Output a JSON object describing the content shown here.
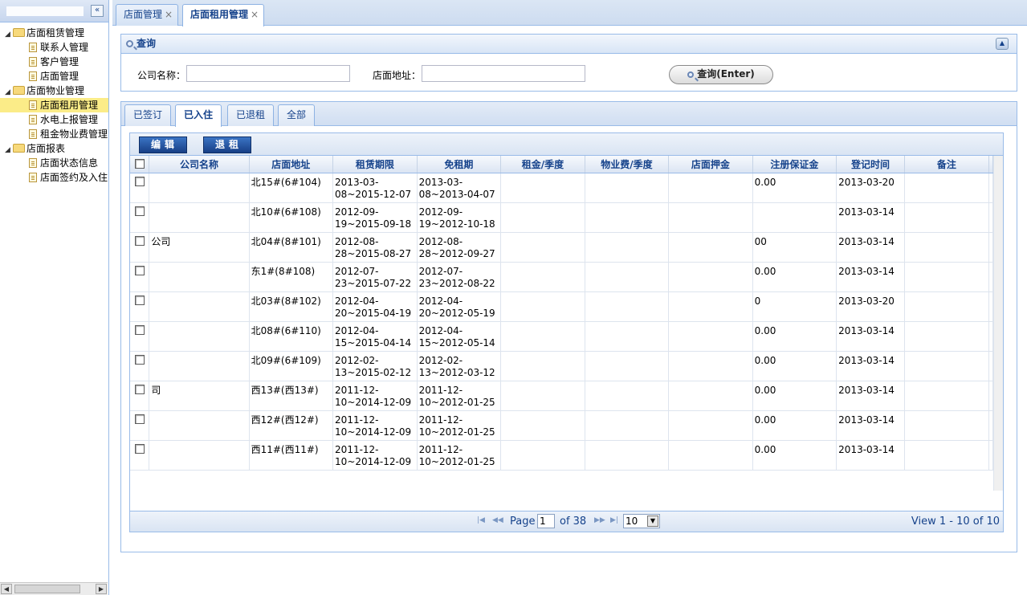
{
  "sidebar": {
    "collapse_glyph": "«",
    "tree": [
      {
        "label": "店面租赁管理",
        "level": 0,
        "icon": "folder-icon"
      },
      {
        "label": "联系人管理",
        "level": 1,
        "icon": "page-icon"
      },
      {
        "label": "客户管理",
        "level": 1,
        "icon": "page-icon"
      },
      {
        "label": "店面管理",
        "level": 1,
        "icon": "page-icon"
      },
      {
        "label": "店面物业管理",
        "level": 0,
        "icon": "folder-icon"
      },
      {
        "label": "店面租用管理",
        "level": 1,
        "icon": "page-icon",
        "selected": true
      },
      {
        "label": "水电上报管理",
        "level": 1,
        "icon": "page-icon"
      },
      {
        "label": "租金物业费管理",
        "level": 1,
        "icon": "page-icon"
      },
      {
        "label": "店面报表",
        "level": 0,
        "icon": "folder-icon"
      },
      {
        "label": "店面状态信息",
        "level": 1,
        "icon": "page-icon"
      },
      {
        "label": "店面签约及入住",
        "level": 1,
        "icon": "page-icon"
      }
    ]
  },
  "top_tabs": [
    {
      "label": "店面管理",
      "close": "×"
    },
    {
      "label": "店面租用管理",
      "close": "×",
      "active": true
    }
  ],
  "query": {
    "title": "查询",
    "company_label": "公司名称：",
    "address_label": "店面地址：",
    "company_value": "",
    "address_value": "",
    "button_label": "查询(Enter)"
  },
  "status_tabs": [
    {
      "label": "已签订"
    },
    {
      "label": "已入住",
      "active": true
    },
    {
      "label": "已退租"
    },
    {
      "label": "全部"
    }
  ],
  "toolbar": {
    "edit_label": "编辑",
    "checkout_label": "退租"
  },
  "grid": {
    "columns": [
      "公司名称",
      "店面地址",
      "租赁期限",
      "免租期",
      "租金/季度",
      "物业费/季度",
      "店面押金",
      "注册保证金",
      "登记时间",
      "备注"
    ],
    "rows": [
      {
        "company": "",
        "address": "北15#(6#104)",
        "lease": "2013-03-08~2015-12-07",
        "free": "2013-03-08~2013-04-07",
        "rent": "",
        "property": "",
        "deposit": "",
        "reg_deposit": "0.00",
        "date": "2013-03-20",
        "note": ""
      },
      {
        "company": "",
        "address": "北10#(6#108)",
        "lease": "2012-09-19~2015-09-18",
        "free": "2012-09-19~2012-10-18",
        "rent": "",
        "property": "",
        "deposit": "",
        "reg_deposit": "",
        "date": "2013-03-14",
        "note": ""
      },
      {
        "company": "公司",
        "address": "北04#(8#101)",
        "lease": "2012-08-28~2015-08-27",
        "free": "2012-08-28~2012-09-27",
        "rent": "",
        "property": "",
        "deposit": "",
        "reg_deposit": "00",
        "date": "2013-03-14",
        "note": ""
      },
      {
        "company": "",
        "address": "东1#(8#108)",
        "lease": "2012-07-23~2015-07-22",
        "free": "2012-07-23~2012-08-22",
        "rent": "",
        "property": "",
        "deposit": "",
        "reg_deposit": "0.00",
        "date": "2013-03-14",
        "note": ""
      },
      {
        "company": "",
        "address": "北03#(8#102)",
        "lease": "2012-04-20~2015-04-19",
        "free": "2012-04-20~2012-05-19",
        "rent": "",
        "property": "",
        "deposit": "",
        "reg_deposit": "0",
        "date": "2013-03-20",
        "note": ""
      },
      {
        "company": "",
        "address": "北08#(6#110)",
        "lease": "2012-04-15~2015-04-14",
        "free": "2012-04-15~2012-05-14",
        "rent": "",
        "property": "",
        "deposit": "",
        "reg_deposit": "0.00",
        "date": "2013-03-14",
        "note": ""
      },
      {
        "company": "",
        "address": "北09#(6#109)",
        "lease": "2012-02-13~2015-02-12",
        "free": "2012-02-13~2012-03-12",
        "rent": "",
        "property": "",
        "deposit": "",
        "reg_deposit": "0.00",
        "date": "2013-03-14",
        "note": ""
      },
      {
        "company": "司",
        "address": "西13#(西13#)",
        "lease": "2011-12-10~2014-12-09",
        "free": "2011-12-10~2012-01-25",
        "rent": "",
        "property": "",
        "deposit": "",
        "reg_deposit": "0.00",
        "date": "2013-03-14",
        "note": ""
      },
      {
        "company": "",
        "address": "西12#(西12#)",
        "lease": "2011-12-10~2014-12-09",
        "free": "2011-12-10~2012-01-25",
        "rent": "",
        "property": "",
        "deposit": "",
        "reg_deposit": "0.00",
        "date": "2013-03-14",
        "note": ""
      },
      {
        "company": "",
        "address": "西11#(西11#)",
        "lease": "2011-12-10~2014-12-09",
        "free": "2011-12-10~2012-01-25",
        "rent": "",
        "property": "",
        "deposit": "",
        "reg_deposit": "0.00",
        "date": "2013-03-14",
        "note": ""
      }
    ]
  },
  "pager": {
    "page_label": "Page",
    "page_value": "1",
    "of_label": "of 38",
    "page_size": "10",
    "view_info": "View 1 - 10 of 10"
  }
}
